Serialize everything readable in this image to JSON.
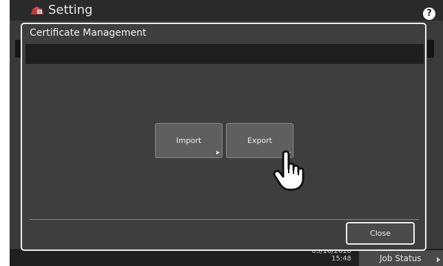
{
  "app": {
    "title": "Setting",
    "help_symbol": "?",
    "title_icon": "setting-icon",
    "help_icon": "help-icon"
  },
  "dialog": {
    "title": "Certificate Management",
    "message": "",
    "buttons": [
      {
        "label": "Import",
        "icon": "arrow-right-icon"
      },
      {
        "label": "Export",
        "icon": "arrow-right-icon"
      }
    ],
    "close_label": "Close"
  },
  "status_bar": {
    "date": "03/10/2018",
    "time": "15:48",
    "job_status_label": "Job Status",
    "job_status_icon": "arrow-right-icon"
  },
  "overlay": {
    "pointer_icon": "hand-pointer-icon"
  },
  "colors": {
    "background": "#3a3a3a",
    "dialog": "#3e3e3e",
    "button": "#5f5f5f",
    "border": "#f0f0f0",
    "text": "#eeeeee"
  }
}
